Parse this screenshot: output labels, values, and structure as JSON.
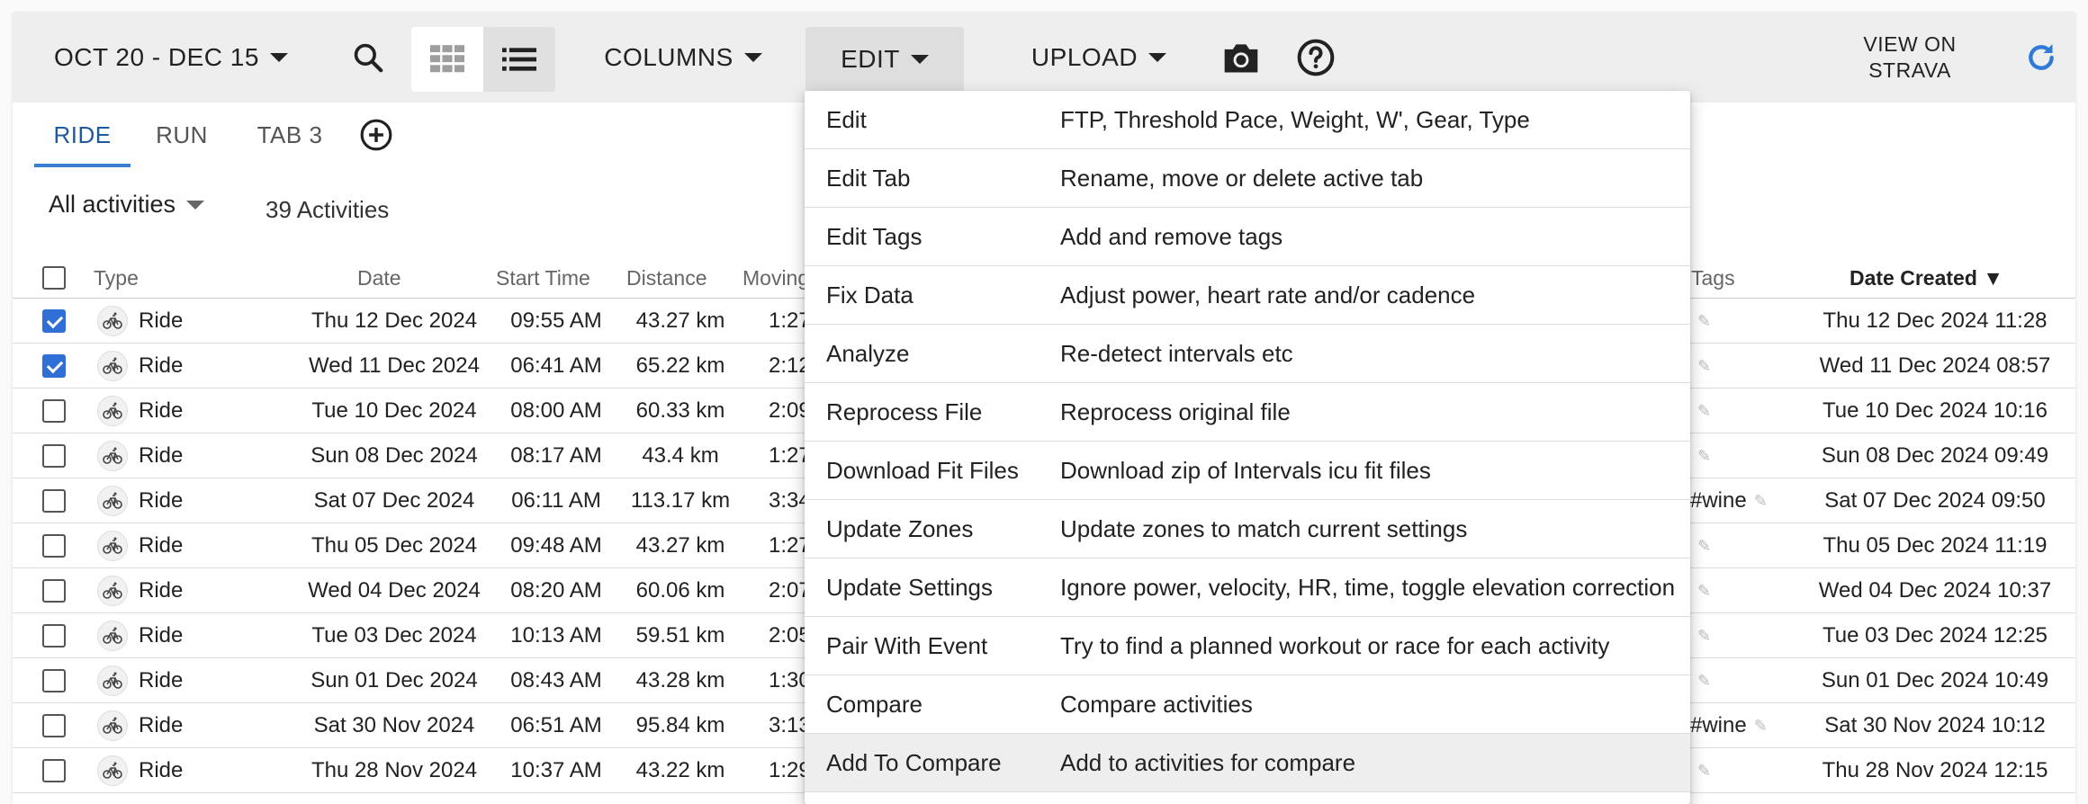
{
  "toolbar": {
    "date_range": "OCT 20 - DEC 15",
    "columns_label": "COLUMNS",
    "edit_label": "EDIT",
    "upload_label": "UPLOAD",
    "view_on_line1": "VIEW ON",
    "view_on_line2": "STRAVA"
  },
  "tabs": [
    {
      "label": "RIDE",
      "active": true
    },
    {
      "label": "RUN"
    },
    {
      "label": "TAB 3"
    }
  ],
  "filter": {
    "label": "All activities",
    "count": "39 Activities"
  },
  "columns": {
    "type": "Type",
    "date": "Date",
    "start_time": "Start Time",
    "distance": "Distance",
    "moving": "Moving",
    "tags": "Tags",
    "date_created": "Date Created ▼"
  },
  "rows": [
    {
      "checked": true,
      "type": "Ride",
      "date": "Thu 12 Dec 2024",
      "start": "09:55 AM",
      "distance": "43.27 km",
      "moving": "1:27",
      "tags": "",
      "created": "Thu 12 Dec 2024 11:28"
    },
    {
      "checked": true,
      "type": "Ride",
      "date": "Wed 11 Dec 2024",
      "start": "06:41 AM",
      "distance": "65.22 km",
      "moving": "2:12",
      "tags": "",
      "created": "Wed 11 Dec 2024 08:57"
    },
    {
      "checked": false,
      "type": "Ride",
      "date": "Tue 10 Dec 2024",
      "start": "08:00 AM",
      "distance": "60.33 km",
      "moving": "2:09",
      "tags": "",
      "created": "Tue 10 Dec 2024 10:16"
    },
    {
      "checked": false,
      "type": "Ride",
      "date": "Sun 08 Dec 2024",
      "start": "08:17 AM",
      "distance": "43.4 km",
      "moving": "1:27",
      "tags": "",
      "created": "Sun 08 Dec 2024 09:49"
    },
    {
      "checked": false,
      "type": "Ride",
      "date": "Sat 07 Dec 2024",
      "start": "06:11 AM",
      "distance": "113.17 km",
      "moving": "3:34",
      "tags": "#wine",
      "created": "Sat 07 Dec 2024 09:50"
    },
    {
      "checked": false,
      "type": "Ride",
      "date": "Thu 05 Dec 2024",
      "start": "09:48 AM",
      "distance": "43.27 km",
      "moving": "1:27",
      "tags": "",
      "created": "Thu 05 Dec 2024 11:19"
    },
    {
      "checked": false,
      "type": "Ride",
      "date": "Wed 04 Dec 2024",
      "start": "08:20 AM",
      "distance": "60.06 km",
      "moving": "2:07",
      "tags": "",
      "created": "Wed 04 Dec 2024 10:37"
    },
    {
      "checked": false,
      "type": "Ride",
      "date": "Tue 03 Dec 2024",
      "start": "10:13 AM",
      "distance": "59.51 km",
      "moving": "2:05",
      "tags": "",
      "created": "Tue 03 Dec 2024 12:25"
    },
    {
      "checked": false,
      "type": "Ride",
      "date": "Sun 01 Dec 2024",
      "start": "08:43 AM",
      "distance": "43.28 km",
      "moving": "1:30",
      "tags": "",
      "created": "Sun 01 Dec 2024 10:49"
    },
    {
      "checked": false,
      "type": "Ride",
      "date": "Sat 30 Nov 2024",
      "start": "06:51 AM",
      "distance": "95.84 km",
      "moving": "3:13",
      "tags": "#wine",
      "created": "Sat 30 Nov 2024 10:12"
    },
    {
      "checked": false,
      "type": "Ride",
      "date": "Thu 28 Nov 2024",
      "start": "10:37 AM",
      "distance": "43.22 km",
      "moving": "1:29",
      "tags": "",
      "created": "Thu 28 Nov 2024 12:15"
    }
  ],
  "menu": [
    {
      "label": "Edit",
      "desc": "FTP, Threshold Pace, Weight, W', Gear, Type"
    },
    {
      "label": "Edit Tab",
      "desc": "Rename, move or delete active tab"
    },
    {
      "label": "Edit Tags",
      "desc": "Add and remove tags"
    },
    {
      "label": "Fix Data",
      "desc": "Adjust power, heart rate and/or cadence"
    },
    {
      "label": "Analyze",
      "desc": "Re-detect intervals etc"
    },
    {
      "label": "Reprocess File",
      "desc": "Reprocess original file"
    },
    {
      "label": "Download Fit Files",
      "desc": "Download zip of Intervals icu fit files"
    },
    {
      "label": "Update Zones",
      "desc": "Update zones to match current settings"
    },
    {
      "label": "Update Settings",
      "desc": "Ignore power, velocity, HR, time, toggle elevation correction"
    },
    {
      "label": "Pair With Event",
      "desc": "Try to find a planned workout or race for each activity"
    },
    {
      "label": "Compare",
      "desc": "Compare activities"
    },
    {
      "label": "Add To Compare",
      "desc": "Add to activities for compare",
      "highlight": true
    }
  ],
  "colors": {
    "accent": "#3b80d1",
    "checkbox": "#2f6fd6",
    "refresh": "#2f7ad6"
  }
}
